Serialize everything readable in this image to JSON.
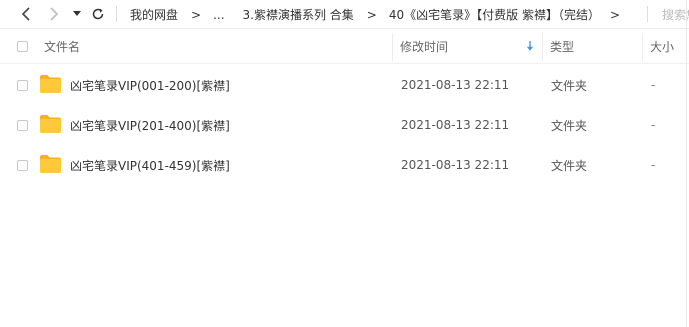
{
  "nav": {
    "back_icon": "chevron-left-icon",
    "forward_icon": "chevron-right-icon",
    "dropdown_icon": "caret-down-icon",
    "refresh_icon": "refresh-icon"
  },
  "breadcrumb": {
    "items": [
      "我的网盘",
      "...",
      "3.紫襟演播系列 合集",
      "40《凶宅笔录》【付费版 紫襟】（完结）"
    ],
    "separator": ">"
  },
  "search": {
    "placeholder": "搜索您的文件"
  },
  "columns": {
    "name": "文件名",
    "modified": "修改时间",
    "type": "类型",
    "size": "大小"
  },
  "sort": {
    "icon": "sort-down-arrow-icon",
    "color": "#3b9de6"
  },
  "files": [
    {
      "name": "凶宅笔录VIP(001-200)[紫襟]",
      "modified": "2021-08-13 22:11",
      "type": "文件夹",
      "size": "-"
    },
    {
      "name": "凶宅笔录VIP(201-400)[紫襟]",
      "modified": "2021-08-13 22:11",
      "type": "文件夹",
      "size": "-"
    },
    {
      "name": "凶宅笔录VIP(401-459)[紫襟]",
      "modified": "2021-08-13 22:11",
      "type": "文件夹",
      "size": "-"
    }
  ],
  "colors": {
    "folder": "#ffc93c",
    "folder_tab": "#f5b21f"
  }
}
